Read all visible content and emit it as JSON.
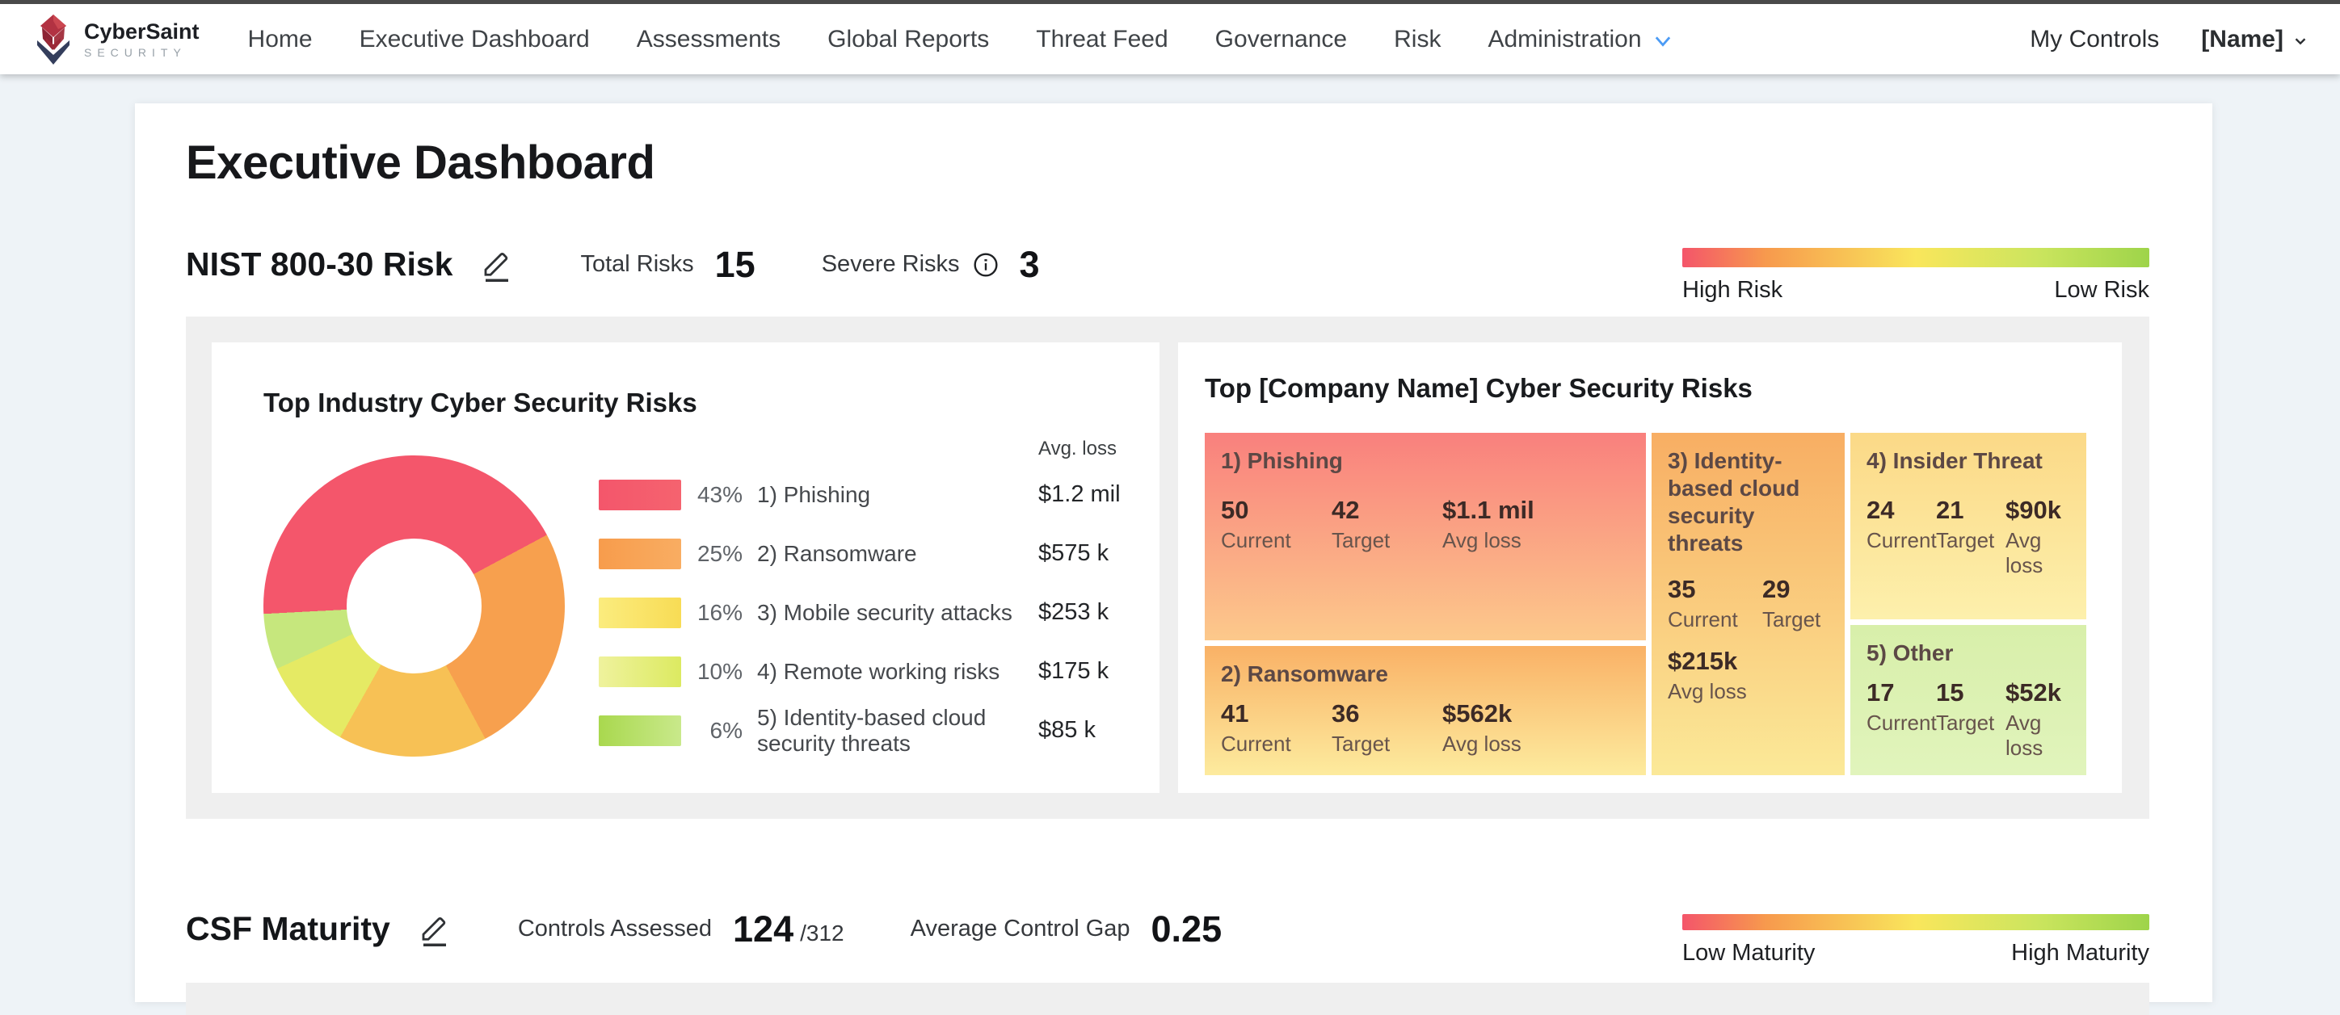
{
  "nav": {
    "brand": {
      "name": "CyberSaint",
      "subtitle": "SECURITY"
    },
    "items": [
      "Home",
      "Executive Dashboard",
      "Assessments",
      "Global Reports",
      "Threat Feed",
      "Governance",
      "Risk"
    ],
    "admin_label": "Administration",
    "admin_chevron_color": "#4b9bf5",
    "my_controls": "My Controls",
    "user_label": "[Name]"
  },
  "page": {
    "title": "Executive Dashboard"
  },
  "risk_section": {
    "title": "NIST 800-30 Risk",
    "total_label": "Total Risks",
    "total_value": "15",
    "severe_label": "Severe Risks",
    "severe_value": "3",
    "scale_left": "High Risk",
    "scale_right": "Low Risk"
  },
  "maturity_section": {
    "title": "CSF Maturity",
    "assessed_label": "Controls Assessed",
    "assessed_value": "124",
    "assessed_total": "/312",
    "gap_label": "Average Control Gap",
    "gap_value": "0.25",
    "scale_left": "Low Maturity",
    "scale_right": "High Maturity"
  },
  "scales": {
    "gradient": "linear-gradient(90deg, #f4556a 0%, #f79a4d 18%, #f9e65c 50%, #cbe55e 76%, #9ed44a 100%)"
  },
  "industry_card": {
    "title": "Top Industry Cyber Security Risks",
    "avg_header": "Avg. loss"
  },
  "company_card": {
    "title": "Top [Company Name] Cyber Security Risks",
    "labels": {
      "current": "Current",
      "target": "Target",
      "avg": "Avg loss"
    }
  },
  "icons": [
    "edit-pencil-icon",
    "info-icon",
    "chevron-down-icon",
    "cybersaint-logo-icon"
  ],
  "chart_data": {
    "donut": {
      "type": "pie",
      "title": "Top Industry Cyber Security Risks",
      "start_angle_deg": 267,
      "inner_radius_pct": 45,
      "legend_position": "right",
      "value_column_header": "Avg. loss",
      "slices": [
        {
          "label": "1) Phishing",
          "pct": 43,
          "pct_label": "43%",
          "avg_loss": "$1.2 mil",
          "color": "#f4566b",
          "swatch": "linear-gradient(90deg, #f4566b, #f5636f)"
        },
        {
          "label": "2) Ransomware",
          "pct": 25,
          "pct_label": "25%",
          "avg_loss": "$575 k",
          "color": "#f7a04e",
          "swatch": "linear-gradient(90deg, #f79c4c, #f9ad62)"
        },
        {
          "label": "3) Mobile security attacks",
          "pct": 16,
          "pct_label": "16%",
          "avg_loss": "$253 k",
          "color": "#f7c155",
          "swatch": "linear-gradient(90deg, #fbec7e, #f8dc55)"
        },
        {
          "label": "4) Remote working risks",
          "pct": 10,
          "pct_label": "10%",
          "avg_loss": "$175 k",
          "color": "#e5ea64",
          "swatch": "linear-gradient(90deg, #eff29d, #dcea61)"
        },
        {
          "label": "5) Identity-based cloud security threats",
          "pct": 6,
          "pct_label": "6%",
          "avg_loss": "$85 k",
          "color": "#c6e77d",
          "swatch": "linear-gradient(90deg, #a9d84e, #c9e98b)"
        }
      ]
    },
    "treemap": {
      "type": "treemap",
      "title": "Top [Company Name] Cyber Security Risks",
      "cells": [
        {
          "name": "1) Phishing",
          "current": "50",
          "target": "42",
          "avg_loss": "$1.1 mil",
          "bg": "linear-gradient(#f9807d, #fcc98b)"
        },
        {
          "name": "2) Ransomware",
          "current": "41",
          "target": "36",
          "avg_loss": "$562k",
          "bg": "linear-gradient(#f9b166, #fdeb9e)"
        },
        {
          "name": "3) Identity-based cloud security threats",
          "current": "35",
          "target": "29",
          "avg_loss": "$215k",
          "bg": "linear-gradient(#f8ae63, #fbe998)"
        },
        {
          "name": "4) Insider Threat",
          "current": "24",
          "target": "21",
          "avg_loss": "$90k",
          "bg": "linear-gradient(#fbd987, #fdf0ac)"
        },
        {
          "name": "5) Other",
          "current": "17",
          "target": "15",
          "avg_loss": "$52k",
          "bg": "linear-gradient(#d8efaa, #e1f4bc)"
        }
      ]
    }
  }
}
